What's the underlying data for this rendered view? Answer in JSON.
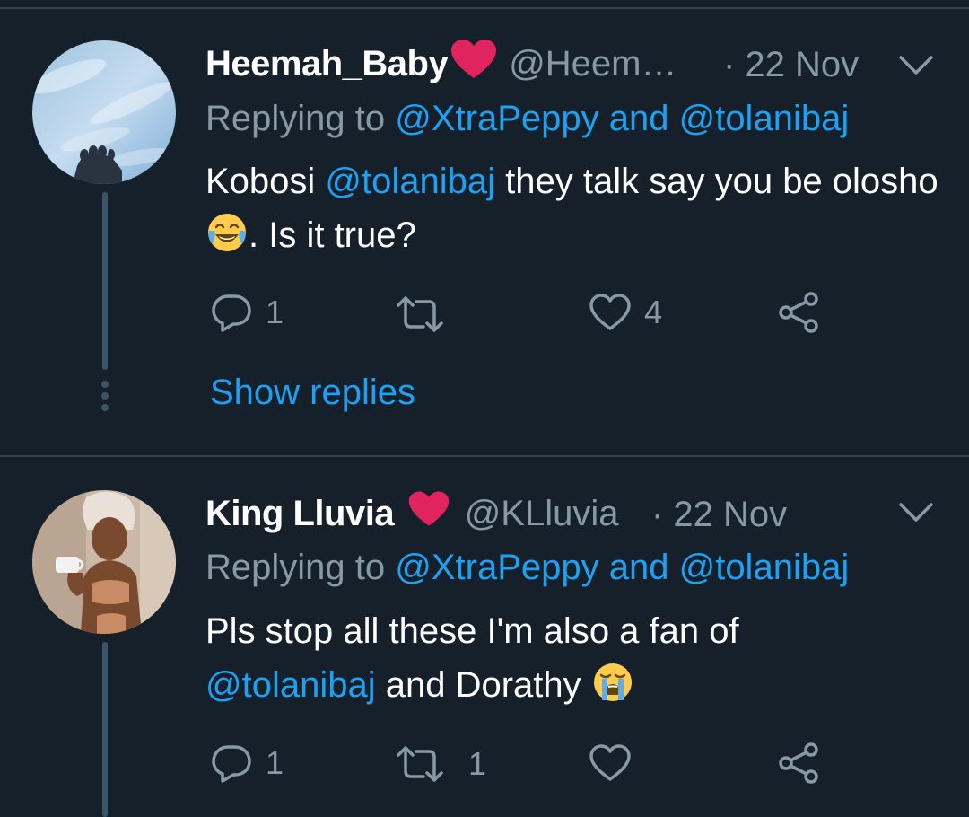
{
  "tweets": [
    {
      "display_name": "Heemah_Baby",
      "handle": "@Heem…",
      "time": "· 22 Nov",
      "replying_prefix": "Replying to ",
      "replying_to_1": "@XtraPeppy",
      "replying_and": " and ",
      "replying_to_2": "@tolanibaj",
      "body_part_1": "Kobosi ",
      "body_mention": "@tolanibaj",
      "body_part_2": " they talk say you be olosho",
      "body_part_3": ". Is it true?",
      "emoji": "face-with-tears-of-joy",
      "reply_count": "1",
      "retweet_count": "",
      "like_count": "4",
      "show_replies": "Show replies"
    },
    {
      "display_name": "King Lluvia ",
      "handle": "@KLluvia",
      "time": "· 22 Nov",
      "replying_prefix": "Replying to ",
      "replying_to_1": "@XtraPeppy",
      "replying_and": " and ",
      "replying_to_2": "@tolanibaj",
      "body_part_1": "Pls stop all these I'm also a fan of ",
      "body_mention": "@tolanibaj",
      "body_part_2": " and Dorathy ",
      "emoji": "loudly-crying-face",
      "reply_count": "1",
      "retweet_count": "1",
      "like_count": ""
    }
  ],
  "colors": {
    "background": "#15202b",
    "divider": "#38444d",
    "secondary_text": "#8899a6",
    "link": "#1da1f2",
    "heart": "#e0245e"
  },
  "icons": [
    "reply-icon",
    "retweet-icon",
    "like-icon",
    "share-icon",
    "chevron-down-icon",
    "red-heart-emoji"
  ]
}
